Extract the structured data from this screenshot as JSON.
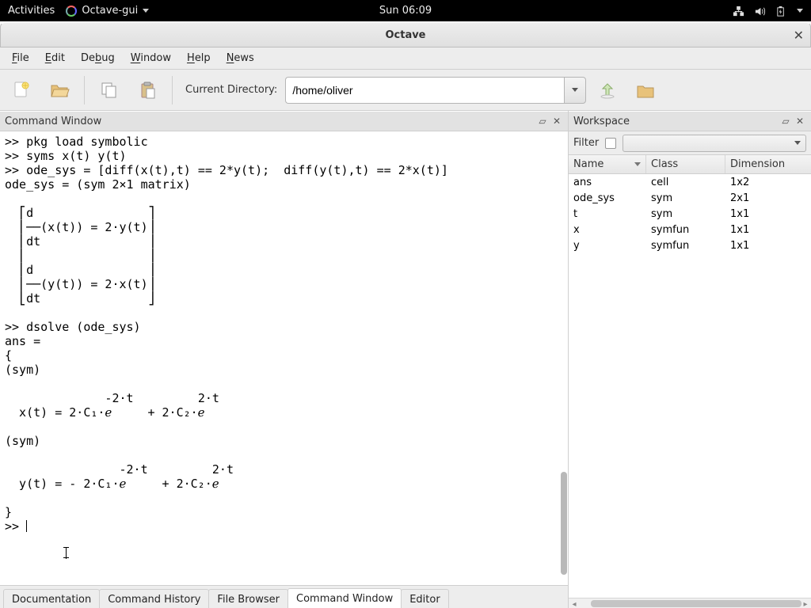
{
  "gnome": {
    "activities": "Activities",
    "app": "Octave-gui",
    "clock": "Sun 06:09"
  },
  "window": {
    "title": "Octave"
  },
  "menu": {
    "file": "File",
    "edit": "Edit",
    "debug": "Debug",
    "window": "Window",
    "help": "Help",
    "news": "News"
  },
  "toolbar": {
    "curdir_label": "Current Directory:",
    "curdir_value": "/home/oliver"
  },
  "panes": {
    "cmdwin": "Command Window",
    "workspace": "Workspace"
  },
  "cmd_output": ">> pkg load symbolic\n>> syms x(t) y(t)\n>> ode_sys = [diff(x(t),t) == 2*y(t);  diff(y(t),t) == 2*x(t)]\node_sys = (sym 2×1 matrix)\n\n  ⎡d                ⎤\n  ⎢──(x(t)) = 2·y(t)⎥\n  ⎢dt               ⎥\n  ⎢                 ⎥\n  ⎢d                ⎥\n  ⎢──(y(t)) = 2·x(t)⎥\n  ⎣dt               ⎦\n\n>> dsolve (ode_sys)\nans =\n{\n(sym)\n\n              -2·t         2·t\n  x(t) = 2·C₁·ℯ     + 2·C₂·ℯ\n\n(sym)\n\n                -2·t         2·t\n  y(t) = - 2·C₁·ℯ     + 2·C₂·ℯ\n\n}\n>> ",
  "tabs": {
    "documentation": "Documentation",
    "command_history": "Command History",
    "file_browser": "File Browser",
    "command_window": "Command Window",
    "editor": "Editor"
  },
  "workspace": {
    "filter_label": "Filter",
    "cols": {
      "name": "Name",
      "class": "Class",
      "dim": "Dimension"
    },
    "rows": [
      {
        "name": "ans",
        "class": "cell",
        "dim": "1x2"
      },
      {
        "name": "ode_sys",
        "class": "sym",
        "dim": "2x1"
      },
      {
        "name": "t",
        "class": "sym",
        "dim": "1x1"
      },
      {
        "name": "x",
        "class": "symfun",
        "dim": "1x1"
      },
      {
        "name": "y",
        "class": "symfun",
        "dim": "1x1"
      }
    ]
  }
}
